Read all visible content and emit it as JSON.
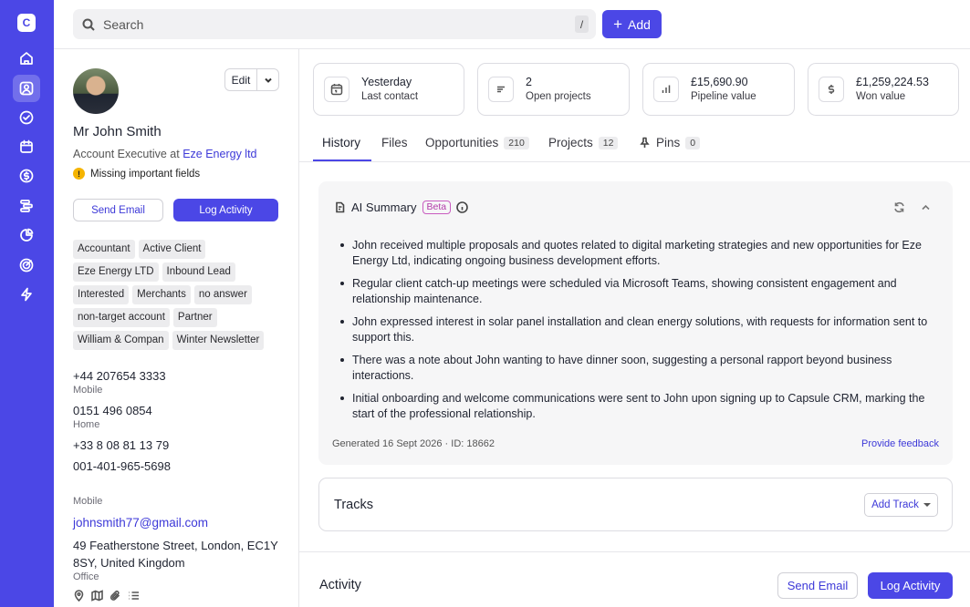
{
  "app": {
    "logo_letter": "C",
    "accent_color": "#4b47e6"
  },
  "nav": [
    {
      "icon": "home-icon"
    },
    {
      "icon": "contacts-icon",
      "active": true
    },
    {
      "icon": "tasks-icon"
    },
    {
      "icon": "calendar-icon"
    },
    {
      "icon": "sales-icon"
    },
    {
      "icon": "projects-icon"
    },
    {
      "icon": "reports-icon"
    },
    {
      "icon": "goals-icon"
    },
    {
      "icon": "workflow-icon"
    }
  ],
  "search": {
    "placeholder": "Search",
    "shortcut": "/"
  },
  "add_button": {
    "label": "Add"
  },
  "contact": {
    "edit_label": "Edit",
    "name": "Mr John Smith",
    "role_prefix": "Account Executive at ",
    "company": "Eze Energy ltd",
    "warning": "Missing important fields",
    "send_email": "Send Email",
    "log_activity": "Log Activity",
    "tags": [
      "Accountant",
      "Active Client",
      "Eze Energy LTD",
      "Inbound Lead",
      "Interested",
      "Merchants",
      "no answer",
      "non-target account",
      "Partner",
      "William & Compan",
      "Winter Newsletter"
    ],
    "phones": [
      {
        "number": "+44 207654 3333",
        "label": "Mobile"
      },
      {
        "number": "0151 496 0854",
        "label": "Home"
      },
      {
        "number": "+33 8 08 81 13 79",
        "label": ""
      },
      {
        "number": "001-401-965-5698",
        "label": ""
      }
    ],
    "email_label": "Mobile",
    "email": "johnsmith77@gmail.com",
    "address": "49 Featherstone Street, London, EC1Y 8SY, United Kingdom",
    "address_label": "Office"
  },
  "stats": [
    {
      "value": "Yesterday",
      "label": "Last contact",
      "icon": "calendar-icon"
    },
    {
      "value": "2",
      "label": "Open projects",
      "icon": "list-icon"
    },
    {
      "value": "£15,690.90",
      "label": "Pipeline value",
      "icon": "bar-chart-icon"
    },
    {
      "value": "£1,259,224.53",
      "label": "Won value",
      "icon": "dollar-icon"
    }
  ],
  "tabs": [
    {
      "label": "History",
      "count": ""
    },
    {
      "label": "Files",
      "count": ""
    },
    {
      "label": "Opportunities",
      "count": "210"
    },
    {
      "label": "Projects",
      "count": "12"
    },
    {
      "label": "Pins",
      "count": "0"
    }
  ],
  "ai_summary": {
    "title": "AI Summary",
    "badge": "Beta",
    "bullets": [
      "John received multiple proposals and quotes related to digital marketing strategies and new opportunities for Eze Energy Ltd, indicating ongoing business development efforts.",
      "Regular client catch-up meetings were scheduled via Microsoft Teams, showing consistent engagement and relationship maintenance.",
      "John expressed interest in solar panel installation and clean energy solutions, with requests for information sent to support this.",
      "There was a note about John wanting to have dinner soon, suggesting a personal rapport beyond business interactions.",
      "Initial onboarding and welcome communications were sent to John upon signing up to Capsule CRM, marking the start of the professional relationship."
    ],
    "meta": "Generated 16 Sept 2026 · ID: 18662",
    "feedback": "Provide feedback"
  },
  "tracks": {
    "title": "Tracks",
    "add_label": "Add Track"
  },
  "activity": {
    "title": "Activity",
    "send_email": "Send Email",
    "log_activity": "Log Activity"
  }
}
